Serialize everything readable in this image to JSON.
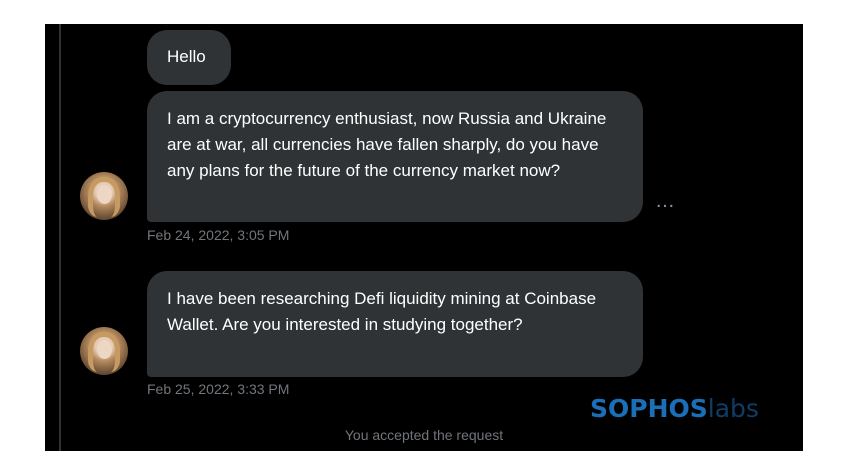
{
  "messages": [
    {
      "text": "Hello"
    },
    {
      "text": "I am a cryptocurrency enthusiast, now Russia and Ukraine are at war, all currencies have fallen sharply, do you have any plans for the future of the currency market now?",
      "timestamp": "Feb 24, 2022, 3:05 PM"
    },
    {
      "text": "I have been researching Defi liquidity mining at Coinbase Wallet. Are you interested in studying together?",
      "timestamp": "Feb 25, 2022, 3:33 PM"
    }
  ],
  "more_icon": "…",
  "footer": {
    "status": "You accepted the request"
  },
  "watermark": {
    "brand": "SOPHOS",
    "suffix": "labs"
  },
  "colors": {
    "background": "#000000",
    "bubble": "#2f3336",
    "muted": "#71767b",
    "brand": "#1a6fb8"
  }
}
